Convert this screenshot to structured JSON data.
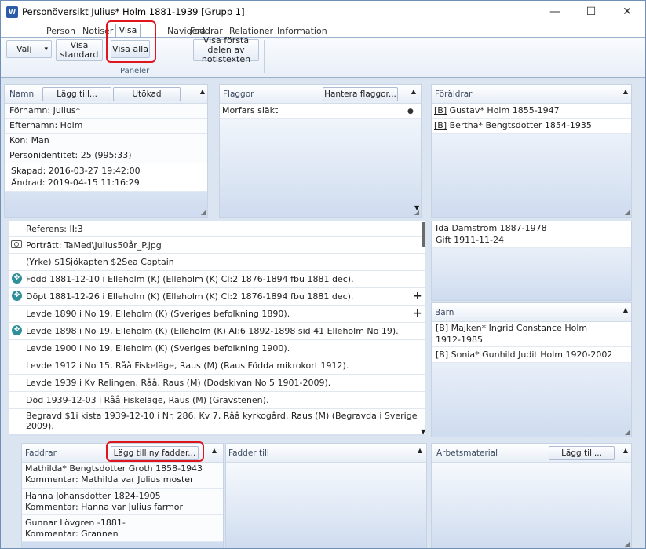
{
  "window": {
    "title": "Personöversikt Julius* Holm 1881-1939 [Grupp 1]",
    "minimize": "—",
    "maximize": "☐",
    "close": "✕",
    "app_icon": "W"
  },
  "menu": [
    "Person",
    "Notiser",
    "Visa",
    "Navigera",
    "Faddrar",
    "Relationer",
    "Information"
  ],
  "ribbon": {
    "valj": "Välj",
    "valj_arrow": "▾",
    "visa_standard": "Visa standard",
    "visa_alla": "Visa alla",
    "visa_forsta": "Visa första delen av notistexten",
    "group_label": "Paneler"
  },
  "namn_panel": {
    "title": "Namn",
    "add_button": "Lägg till...",
    "extended_button": "Utökad",
    "rows": [
      "Förnamn: Julius*",
      "Efternamn: Holm",
      "Kön: Man",
      "Personidentitet: 25 (995:33)"
    ],
    "created": "Skapad:  2016-03-27 19:42:00",
    "changed": "Ändrad:  2019-04-15 11:16:29"
  },
  "flaggor_panel": {
    "title": "Flaggor",
    "manage_button": "Hantera flaggor...",
    "rows": [
      "Morfars släkt"
    ]
  },
  "foraldrar_panel": {
    "title": "Föräldrar",
    "rows": [
      {
        "tag": "[B]",
        "text": "Gustav* Holm  1855-1947"
      },
      {
        "tag": "[B]",
        "text": "Bertha* Bengtsdotter  1854-1935"
      }
    ]
  },
  "events": [
    {
      "icon": "none",
      "text": "Referens: II:3"
    },
    {
      "icon": "camera-icon",
      "text": "Porträtt: TaMed\\Julius50år_P.jpg"
    },
    {
      "icon": "none",
      "text": "(Yrke) $1Sjökapten $2Sea Captain"
    },
    {
      "icon": "source-icon",
      "text": "Född 1881-12-10 i Elleholm (K) (Elleholm (K) CI:2 1876-1894 fbu 1881 dec)."
    },
    {
      "icon": "source-icon",
      "text": "Döpt 1881-12-26 i Elleholm (K) (Elleholm (K) CI:2 1876-1894 fbu 1881 dec)."
    },
    {
      "icon": "none",
      "text": "Levde 1890 i No 19, Elleholm (K) (Sveriges befolkning 1890)."
    },
    {
      "icon": "source-icon",
      "text": "Levde 1898 i No 19, Elleholm (K) (Elleholm (K) AI:6 1892-1898 sid  41 Elleholm No 19)."
    },
    {
      "icon": "none",
      "text": "Levde 1900 i No 19, Elleholm (K) (Sveriges befolkning 1900)."
    },
    {
      "icon": "none",
      "text": "Levde 1912 i No 15, Råå Fiskeläge, Raus (M) (Raus Födda mikrokort 1912)."
    },
    {
      "icon": "none",
      "text": "Levde 1939 i Kv Relingen, Råå, Raus (M) (Dodskivan No 5 1901-2009)."
    },
    {
      "icon": "none",
      "text": "Död 1939-12-03 i Råå Fiskeläge, Raus (M) (Gravstenen)."
    },
    {
      "icon": "none",
      "text": "Begravd $1i kista 1939-12-10 i Nr. 286, Kv 7, Råå kyrkogård, Raus (M) (Begravda i Sverige",
      "text2": "2009)."
    }
  ],
  "spouse_panel": {
    "line1": "Ida Damström  1887-1978",
    "line2": "Gift 1911-11-24"
  },
  "barn_panel": {
    "title": "Barn",
    "rows": [
      {
        "line1": "[B]  Majken* Ingrid Constance Holm",
        "line2": "1912-1985"
      },
      {
        "line1": "[B]  Sonia* Gunhild Judit Holm  1920-2002",
        "line2": ""
      }
    ]
  },
  "faddrar_panel": {
    "title": "Faddrar",
    "add_button": "Lägg till ny fadder...",
    "rows": [
      {
        "name": "Mathilda* Bengtsdotter Groth  1858-1943",
        "comment": "Kommentar:  Mathilda var Julius moster"
      },
      {
        "name": "Hanna Johansdotter  1824-1905",
        "comment": "Kommentar:  Hanna var Julius farmor"
      },
      {
        "name": "Gunnar Lövgren  -1881-",
        "comment": "Kommentar:  Grannen"
      }
    ]
  },
  "fadder_till_panel": {
    "title": "Fadder till"
  },
  "arbetsmaterial_panel": {
    "title": "Arbetsmaterial",
    "add_button": "Lägg till..."
  },
  "glyphs": {
    "up": "▲",
    "down": "▼",
    "grip": "◢",
    "plus": "+",
    "dot": "●"
  },
  "colors": {
    "highlight": "#e0161e",
    "panel_bg": "#dbe5f2",
    "accent": "#2a5caa"
  }
}
